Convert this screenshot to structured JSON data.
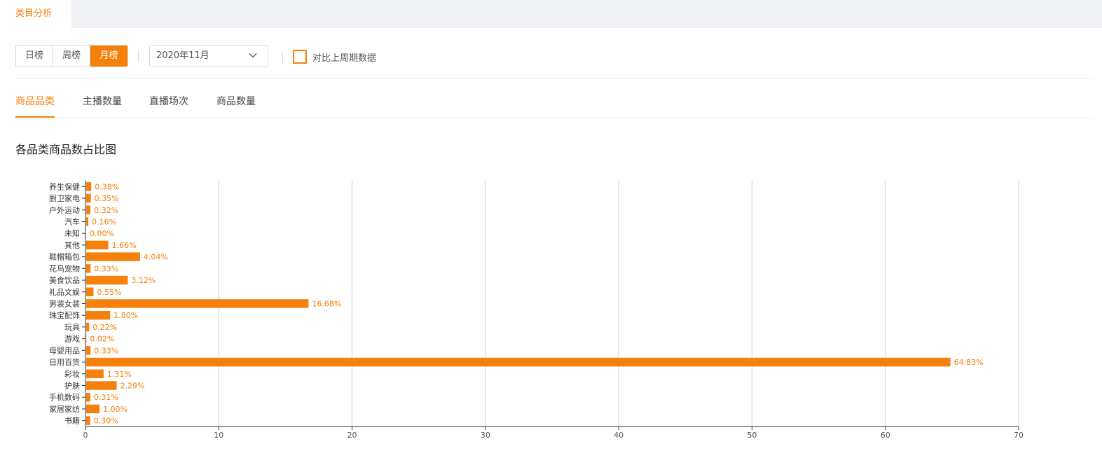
{
  "tabs": {
    "active": "类目分析"
  },
  "period_toggle": {
    "options": [
      "日榜",
      "周榜",
      "月榜"
    ],
    "selected": "月榜"
  },
  "date_select": {
    "value": "2020年11月"
  },
  "compare": {
    "label": "对比上周期数据",
    "checked": false
  },
  "metric_tabs": {
    "items": [
      "商品品类",
      "主播数量",
      "直播场次",
      "商品数量"
    ],
    "active": "商品品类"
  },
  "section": {
    "title": "各品类商品数占比图"
  },
  "colors": {
    "accent": "#f6800c",
    "bar": "#f6800c",
    "grid": "#cccccc"
  },
  "chart_data": {
    "type": "bar",
    "orientation": "horizontal",
    "title": "各品类商品数占比图",
    "categories": [
      "养生保健",
      "厨卫家电",
      "户外运动",
      "汽车",
      "未知",
      "其他",
      "鞋帽箱包",
      "花鸟宠物",
      "美食饮品",
      "礼品文娱",
      "男装女装",
      "珠宝配饰",
      "玩具",
      "游戏",
      "母婴用品",
      "日用百货",
      "彩妆",
      "护肤",
      "手机数码",
      "家居家纺",
      "书籍"
    ],
    "values": [
      0.38,
      0.35,
      0.32,
      0.16,
      0.0,
      1.66,
      4.04,
      0.33,
      3.12,
      0.55,
      16.68,
      1.8,
      0.22,
      0.02,
      0.33,
      64.83,
      1.31,
      2.29,
      0.31,
      1.0,
      0.3
    ],
    "labels": [
      "0.38%",
      "0.35%",
      "0.32%",
      "0.16%",
      "0.00%",
      "1.66%",
      "4.04%",
      "0.33%",
      "3.12%",
      "0.55%",
      "16.68%",
      "1.80%",
      "0.22%",
      "0.02%",
      "0.33%",
      "64.83%",
      "1.31%",
      "2.29%",
      "0.31%",
      "1.00%",
      "0.30%"
    ],
    "xlim": [
      0,
      70
    ],
    "xticks": [
      0,
      10,
      20,
      30,
      40,
      50,
      60,
      70
    ],
    "grid": true,
    "legend": false
  }
}
